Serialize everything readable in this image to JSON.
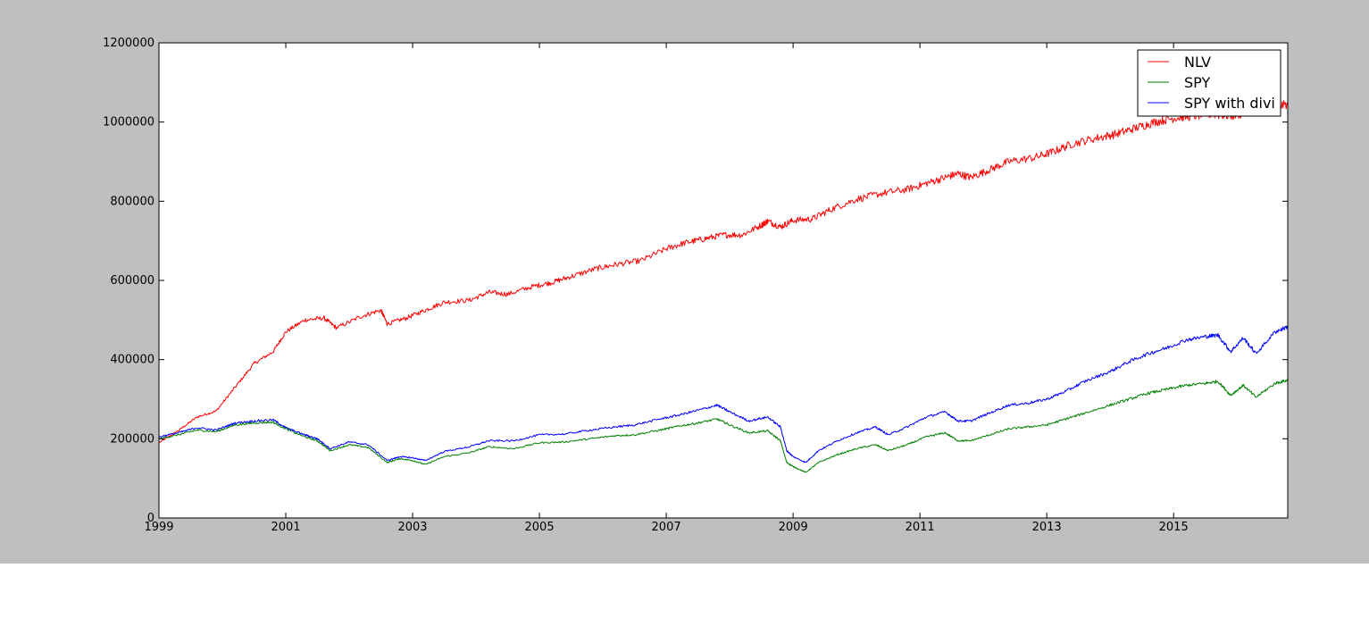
{
  "chart_data": {
    "type": "line",
    "title": "",
    "xlabel": "",
    "ylabel": "",
    "xlim": [
      1999.0,
      2016.8
    ],
    "ylim": [
      0,
      1200000
    ],
    "x_ticks": [
      1999,
      2001,
      2003,
      2005,
      2007,
      2009,
      2011,
      2013,
      2015
    ],
    "x_tick_labels": [
      "1999",
      "2001",
      "2003",
      "2005",
      "2007",
      "2009",
      "2011",
      "2013",
      "2015"
    ],
    "y_ticks": [
      0,
      200000,
      400000,
      600000,
      800000,
      1000000,
      1200000
    ],
    "y_tick_labels": [
      "0",
      "200000",
      "400000",
      "600000",
      "800000",
      "1000000",
      "1200000"
    ],
    "grid": false,
    "legend_position": "top-right",
    "series": [
      {
        "name": "NLV",
        "color": "#ff0000",
        "x": [
          1999.0,
          1999.3,
          1999.6,
          1999.9,
          2000.2,
          2000.5,
          2000.8,
          2001.0,
          2001.3,
          2001.6,
          2001.8,
          2002.2,
          2002.5,
          2002.6,
          2002.9,
          2003.2,
          2003.5,
          2003.9,
          2004.2,
          2004.5,
          2004.9,
          2005.2,
          2005.5,
          2005.9,
          2006.2,
          2006.6,
          2007.0,
          2007.3,
          2007.6,
          2007.9,
          2008.2,
          2008.5,
          2008.6,
          2008.8,
          2009.0,
          2009.3,
          2009.6,
          2010.0,
          2010.4,
          2010.8,
          2011.1,
          2011.4,
          2011.6,
          2011.8,
          2012.1,
          2012.4,
          2012.8,
          2013.1,
          2013.4,
          2013.8,
          2014.1,
          2014.4,
          2014.7,
          2015.0,
          2015.3,
          2015.6,
          2015.9,
          2016.2,
          2016.5,
          2016.8
        ],
        "values": [
          190000,
          220000,
          255000,
          270000,
          330000,
          390000,
          420000,
          470000,
          500000,
          505000,
          480000,
          510000,
          525000,
          490000,
          505000,
          525000,
          545000,
          550000,
          570000,
          565000,
          585000,
          595000,
          610000,
          630000,
          640000,
          650000,
          680000,
          695000,
          705000,
          715000,
          715000,
          740000,
          750000,
          735000,
          752000,
          755000,
          780000,
          805000,
          820000,
          830000,
          845000,
          860000,
          870000,
          860000,
          880000,
          900000,
          910000,
          925000,
          945000,
          960000,
          970000,
          985000,
          1000000,
          1010000,
          1015000,
          1020000,
          1015000,
          1025000,
          1035000,
          1045000
        ]
      },
      {
        "name": "SPY",
        "color": "#008000",
        "x": [
          1999.0,
          1999.3,
          1999.6,
          1999.9,
          2000.2,
          2000.5,
          2000.8,
          2001.0,
          2001.3,
          2001.5,
          2001.7,
          2002.0,
          2002.3,
          2002.6,
          2002.8,
          2003.0,
          2003.2,
          2003.5,
          2003.9,
          2004.2,
          2004.6,
          2005.0,
          2005.4,
          2005.8,
          2006.2,
          2006.5,
          2006.9,
          2007.2,
          2007.5,
          2007.8,
          2008.0,
          2008.3,
          2008.6,
          2008.8,
          2008.9,
          2009.0,
          2009.2,
          2009.4,
          2009.7,
          2010.0,
          2010.3,
          2010.5,
          2010.8,
          2011.1,
          2011.4,
          2011.6,
          2011.8,
          2012.1,
          2012.4,
          2012.7,
          2013.0,
          2013.3,
          2013.6,
          2014.0,
          2014.3,
          2014.6,
          2014.9,
          2015.2,
          2015.5,
          2015.7,
          2015.9,
          2016.1,
          2016.3,
          2016.6,
          2016.8
        ],
        "values": [
          200000,
          210000,
          222000,
          218000,
          235000,
          240000,
          242000,
          225000,
          205000,
          195000,
          170000,
          185000,
          178000,
          140000,
          150000,
          145000,
          135000,
          155000,
          165000,
          180000,
          175000,
          190000,
          192000,
          200000,
          208000,
          210000,
          222000,
          232000,
          240000,
          250000,
          235000,
          215000,
          220000,
          195000,
          140000,
          130000,
          115000,
          140000,
          160000,
          175000,
          185000,
          170000,
          185000,
          205000,
          215000,
          195000,
          195000,
          210000,
          225000,
          230000,
          235000,
          250000,
          265000,
          285000,
          300000,
          315000,
          325000,
          335000,
          340000,
          345000,
          310000,
          335000,
          305000,
          340000,
          348000
        ]
      },
      {
        "name": "SPY with divi",
        "color": "#0000ff",
        "x": [
          1999.0,
          1999.3,
          1999.6,
          1999.9,
          2000.2,
          2000.5,
          2000.8,
          2001.0,
          2001.3,
          2001.5,
          2001.7,
          2002.0,
          2002.3,
          2002.6,
          2002.8,
          2003.0,
          2003.2,
          2003.5,
          2003.9,
          2004.2,
          2004.6,
          2005.0,
          2005.4,
          2005.8,
          2006.2,
          2006.5,
          2006.9,
          2007.2,
          2007.5,
          2007.8,
          2008.0,
          2008.3,
          2008.6,
          2008.8,
          2008.9,
          2009.0,
          2009.2,
          2009.4,
          2009.7,
          2010.0,
          2010.3,
          2010.5,
          2010.8,
          2011.1,
          2011.4,
          2011.6,
          2011.8,
          2012.1,
          2012.4,
          2012.7,
          2013.0,
          2013.3,
          2013.6,
          2014.0,
          2014.3,
          2014.6,
          2014.9,
          2015.2,
          2015.5,
          2015.7,
          2015.9,
          2016.1,
          2016.3,
          2016.6,
          2016.8
        ],
        "values": [
          205000,
          215000,
          228000,
          222000,
          240000,
          245000,
          248000,
          228000,
          210000,
          200000,
          175000,
          192000,
          185000,
          145000,
          155000,
          152000,
          145000,
          168000,
          180000,
          195000,
          195000,
          210000,
          212000,
          222000,
          230000,
          235000,
          250000,
          260000,
          272000,
          285000,
          268000,
          245000,
          255000,
          230000,
          170000,
          155000,
          140000,
          170000,
          195000,
          215000,
          230000,
          210000,
          230000,
          255000,
          268000,
          245000,
          245000,
          265000,
          285000,
          290000,
          300000,
          320000,
          345000,
          370000,
          395000,
          415000,
          430000,
          450000,
          458000,
          462000,
          420000,
          455000,
          415000,
          470000,
          483000
        ]
      }
    ]
  }
}
